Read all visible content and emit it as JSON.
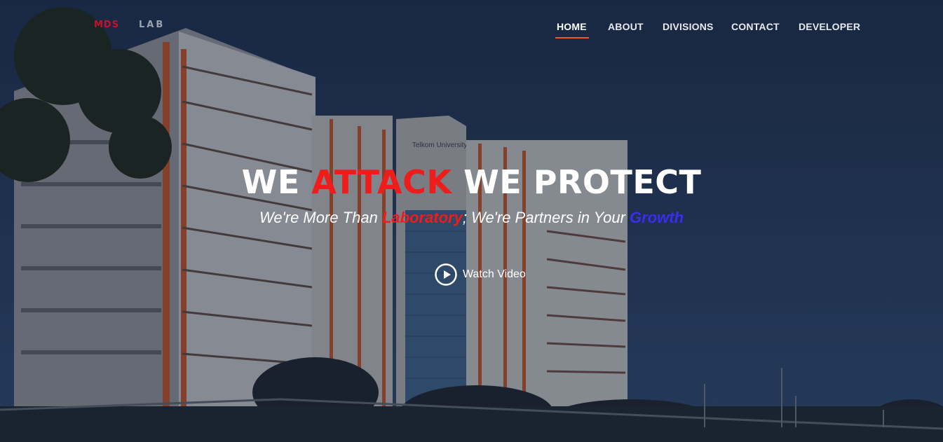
{
  "brand": {
    "logo_main": "MDS",
    "logo_sub": "LAB"
  },
  "nav": {
    "items": [
      {
        "label": "HOME",
        "active": true
      },
      {
        "label": "ABOUT",
        "active": false
      },
      {
        "label": "DIVISIONS",
        "active": false
      },
      {
        "label": "CONTACT",
        "active": false
      },
      {
        "label": "DEVELOPER",
        "active": false
      }
    ]
  },
  "hero": {
    "title_part1": "WE",
    "title_highlight": "ATTACK",
    "title_part2": "WE PROTECT",
    "subtitle_part1": "We're More Than",
    "subtitle_highlight1": "Laboratory",
    "subtitle_part2": "; We're Partners in Your",
    "subtitle_highlight2": "Growth",
    "watch_video_label": "Watch Video",
    "background_sign": "Telkom University"
  },
  "colors": {
    "accent_red": "#ef1c1c",
    "accent_blue": "#3d2cf0",
    "nav_underline": "#e85b2a"
  },
  "icons": {
    "play": "play-circle-icon"
  }
}
